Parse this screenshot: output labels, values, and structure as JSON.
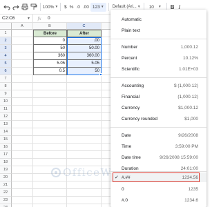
{
  "toolbar": {
    "zoom": "100%",
    "currency_label": "$",
    "percent_label": "%",
    "decimal_decrease": ".0",
    "decimal_increase": ".00",
    "more_formats": "123",
    "font": "Default (Ari...",
    "font_size": "10",
    "bold": "B",
    "italic": "I"
  },
  "formula_bar": {
    "name_box": "C2:C6",
    "fx": "fx",
    "value": "0"
  },
  "grid": {
    "columns": [
      "A",
      "B",
      "C",
      "D"
    ],
    "rows": [
      "1",
      "2",
      "3",
      "4",
      "5",
      "6",
      "7",
      "8",
      "9",
      "10",
      "11",
      "12",
      "13",
      "14",
      "15",
      "16",
      "17",
      "18",
      "19",
      "20",
      "21",
      "22",
      "23",
      "24"
    ],
    "header_before": "Before",
    "header_after": "After",
    "before_values": [
      "0",
      "50",
      "360",
      "5.05",
      "0.5"
    ],
    "after_values": [
      ".00",
      "50.00",
      "360.00",
      "5.05",
      "50"
    ]
  },
  "menu": {
    "items": [
      {
        "label": "Automatic",
        "value": ""
      },
      {
        "label": "Plain text",
        "value": ""
      },
      {
        "label": "Number",
        "value": "1,000.12"
      },
      {
        "label": "Percent",
        "value": "10.12%"
      },
      {
        "label": "Scientific",
        "value": "1.01E+03"
      },
      {
        "label": "Accounting",
        "value": "$ (1,000.12)"
      },
      {
        "label": "Financial",
        "value": "(1,000.12)"
      },
      {
        "label": "Currency",
        "value": "$1,000.12"
      },
      {
        "label": "Currency rounded",
        "value": "$1,000"
      },
      {
        "label": "Date",
        "value": "9/26/2008"
      },
      {
        "label": "Time",
        "value": "3:59:00 PM"
      },
      {
        "label": "Date time",
        "value": "9/26/2008 15:59:00"
      },
      {
        "label": "Duration",
        "value": "24:01:00"
      },
      {
        "label": "#.##",
        "value": "1234.56"
      },
      {
        "label": "0",
        "value": "1235"
      },
      {
        "label": "#.0",
        "value": "1234.6"
      }
    ]
  },
  "watermark": "OfficeWheel",
  "colors": {
    "header_fill": "#d9ead3",
    "selection": "#1a73e8",
    "highlight_box": "#d93025"
  }
}
